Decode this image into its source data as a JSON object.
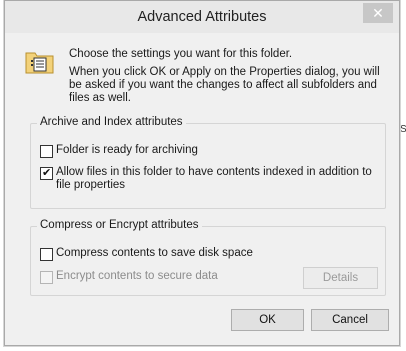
{
  "background": {
    "fragment_top": "PARTIAL",
    "fragment_right": "S"
  },
  "dialog": {
    "title": "Advanced Attributes",
    "close_glyph": "✕",
    "intro": "Choose the settings you want for this folder.",
    "detail": "When you click OK or Apply on the Properties dialog, you will be asked if you want the changes to affect all subfolders and files as well.",
    "icons": {
      "folder": "folder-settings-icon",
      "close": "close-icon"
    }
  },
  "archive_group": {
    "title": "Archive and Index attributes",
    "items": [
      {
        "label": "Folder is ready for archiving",
        "checked": false
      },
      {
        "label": "Allow files in this folder to have contents indexed in addition to file properties",
        "checked": true
      }
    ]
  },
  "compress_group": {
    "title": "Compress or Encrypt attributes",
    "items": [
      {
        "label": "Compress contents to save disk space",
        "checked": false
      },
      {
        "label": "Encrypt contents to secure data",
        "checked": false,
        "disabled": true
      }
    ],
    "details_label": "Details"
  },
  "buttons": {
    "ok": "OK",
    "cancel": "Cancel"
  }
}
